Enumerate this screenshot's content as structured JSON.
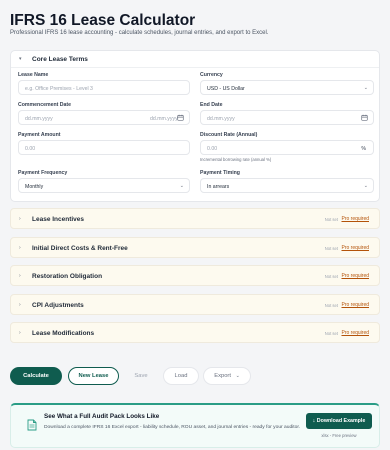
{
  "header": {
    "title": "IFRS 16 Lease Calculator",
    "subtitle": "Professional IFRS 16 lease accounting - calculate schedules, journal entries, and export to Excel."
  },
  "core": {
    "title": "Core Lease Terms",
    "lease_name": {
      "label": "Lease Name",
      "placeholder": "e.g. Office Premises - Level 3"
    },
    "currency": {
      "label": "Currency",
      "value": "USD - US Dollar"
    },
    "commencement_date": {
      "label": "Commencement Date",
      "placeholder_left": "dd.mm.yyyy",
      "placeholder_right": "dd.mm.yyyy"
    },
    "end_date": {
      "label": "End Date",
      "placeholder": "dd.mm.yyyy"
    },
    "payment_amount": {
      "label": "Payment Amount",
      "placeholder": "0.00"
    },
    "discount_rate": {
      "label": "Discount Rate (Annual)",
      "placeholder": "0.00",
      "suffix": "%",
      "hint": "Incremental borrowing rate (annual %)"
    },
    "payment_frequency": {
      "label": "Payment Frequency",
      "value": "Monthly"
    },
    "payment_timing": {
      "label": "Payment Timing",
      "value": "In arrears"
    }
  },
  "sections": [
    {
      "title": "Lease Incentives",
      "status": "Not set",
      "action": "Pro required"
    },
    {
      "title": "Initial Direct Costs & Rent-Free",
      "status": "Not set",
      "action": "Pro required"
    },
    {
      "title": "Restoration Obligation",
      "status": "Not set",
      "action": "Pro required"
    },
    {
      "title": "CPI Adjustments",
      "status": "Not set",
      "action": "Pro required"
    },
    {
      "title": "Lease Modifications",
      "status": "Not set",
      "action": "Pro required"
    }
  ],
  "actions": {
    "calculate": "Calculate",
    "new_lease": "New Lease",
    "save": "Save",
    "load": "Load",
    "export": "Export"
  },
  "promo": {
    "title": "See What a Full Audit Pack Looks Like",
    "body": "Download a complete IFRS 16 Excel export - liability schedule, ROU asset, and journal entries - ready for your auditor.",
    "button": "Download Example",
    "button_sub": "xlsx - Free preview"
  },
  "colors": {
    "primary": "#0f5c4f",
    "accent": "#2a9d86",
    "pro": "#b45309",
    "section_bg": "#fdfaef"
  }
}
